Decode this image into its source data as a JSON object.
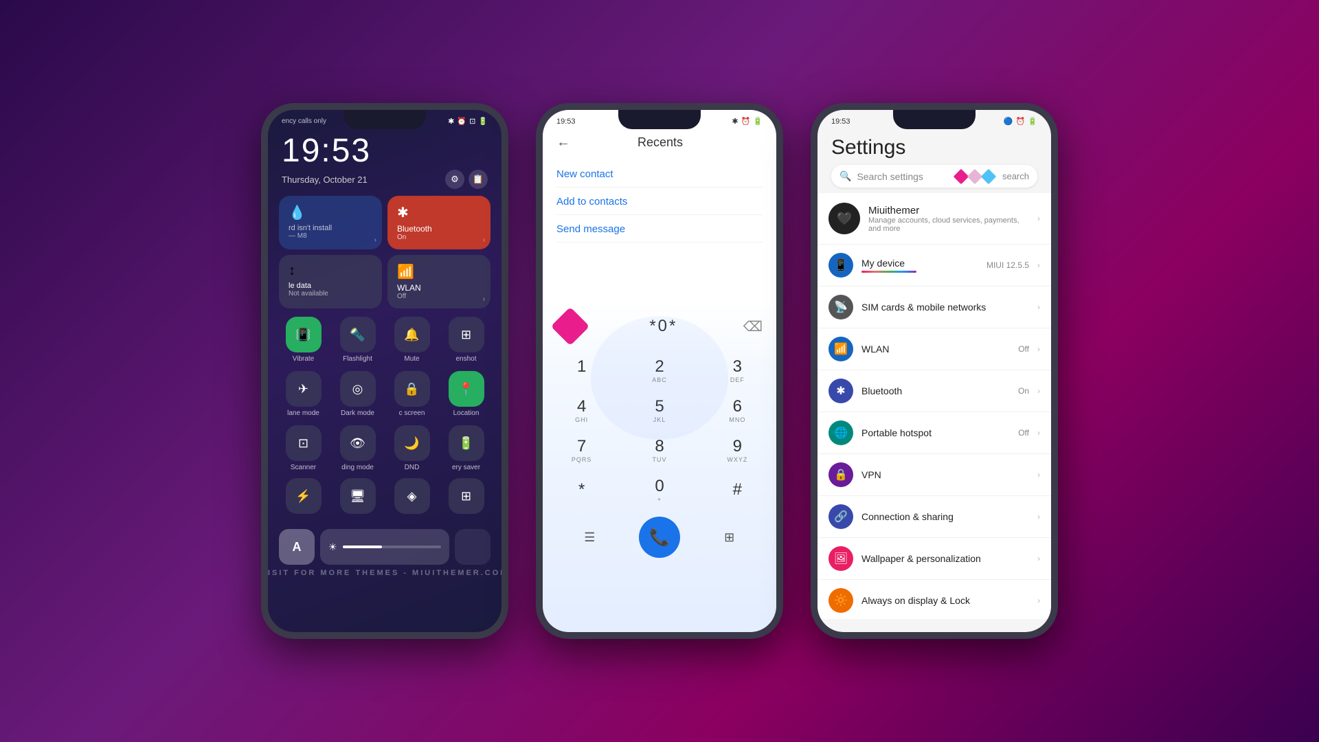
{
  "background": "#4a0060",
  "phone1": {
    "status": {
      "left": "ency calls only",
      "time": "19:53",
      "icons": [
        "bluetooth",
        "alarm",
        "screenshot",
        "battery"
      ]
    },
    "time": "19:53",
    "date": "Thursday, October 21",
    "tiles": [
      {
        "label": "M8",
        "sub": "rd isn't install",
        "icon": "💧",
        "type": "blue"
      },
      {
        "label": "Bluetooth",
        "sub": "On",
        "icon": "✱",
        "type": "red"
      },
      {
        "label": "le data",
        "sub": "Not available",
        "icon": "↕",
        "type": "gray"
      },
      {
        "label": "WLAN",
        "sub": "Off",
        "icon": "WiFi",
        "type": "gray"
      }
    ],
    "quick_actions_row1": [
      {
        "label": "Vibrate",
        "icon": "📳",
        "active": true
      },
      {
        "label": "Flashlight",
        "icon": "🔦",
        "active": false
      },
      {
        "label": "Mute",
        "icon": "🔔",
        "active": false
      },
      {
        "label": "enshot",
        "icon": "⊞",
        "active": false
      }
    ],
    "quick_actions_row2": [
      {
        "label": "lane mode",
        "icon": "✈",
        "active": false
      },
      {
        "label": "Dark mode",
        "icon": "◎",
        "active": false
      },
      {
        "label": "c screen",
        "icon": "🔒",
        "active": false
      },
      {
        "label": "Location",
        "icon": "◈",
        "active": true
      }
    ],
    "quick_actions_row3": [
      {
        "label": "Scanner",
        "icon": "⊡",
        "active": false
      },
      {
        "label": "ding mode",
        "icon": "👁",
        "active": false
      },
      {
        "label": "DND",
        "icon": "🌙",
        "active": false
      },
      {
        "label": "ery saver",
        "icon": "🔋",
        "active": false
      }
    ],
    "quick_actions_row4": [
      {
        "icon": "⚡",
        "active": false
      },
      {
        "icon": "⊟",
        "active": false
      },
      {
        "icon": "◈",
        "active": false
      },
      {
        "icon": "⊞",
        "active": false
      }
    ]
  },
  "phone2": {
    "status_time": "19:53",
    "header_title": "Recents",
    "back_icon": "←",
    "actions": [
      {
        "label": "New contact"
      },
      {
        "label": "Add to contacts"
      },
      {
        "label": "Send message"
      }
    ],
    "dial_number": "*0*",
    "dialpad": [
      {
        "num": "1",
        "alpha": ""
      },
      {
        "num": "2",
        "alpha": "ABC"
      },
      {
        "num": "3",
        "alpha": "DEF"
      },
      {
        "num": "4",
        "alpha": "GHI"
      },
      {
        "num": "5",
        "alpha": "JKL"
      },
      {
        "num": "6",
        "alpha": "MNO"
      },
      {
        "num": "7",
        "alpha": "PQRS"
      },
      {
        "num": "8",
        "alpha": "TUV"
      },
      {
        "num": "9",
        "alpha": "WXYZ"
      },
      {
        "num": "*",
        "alpha": ""
      },
      {
        "num": "0",
        "alpha": "+"
      },
      {
        "num": "#",
        "alpha": ""
      }
    ]
  },
  "phone3": {
    "status_time": "19:53",
    "title": "Settings",
    "search_placeholder": "Search settings",
    "search_btn": "search",
    "profile": {
      "name": "Miuithemer",
      "sub": "Manage accounts, cloud services, payments, and more",
      "icon": "🖤"
    },
    "my_device": {
      "label": "My device",
      "value": "MIUI 12.5.5"
    },
    "settings_items": [
      {
        "label": "SIM cards & mobile networks",
        "icon": "📡",
        "color": "si-gray",
        "value": ""
      },
      {
        "label": "WLAN",
        "icon": "📶",
        "color": "si-blue",
        "value": "Off"
      },
      {
        "label": "Bluetooth",
        "icon": "✱",
        "color": "si-indigo",
        "value": "On"
      },
      {
        "label": "Portable hotspot",
        "icon": "🌐",
        "color": "si-green",
        "value": "Off"
      },
      {
        "label": "VPN",
        "icon": "🔒",
        "color": "si-purple",
        "value": ""
      },
      {
        "label": "Connection & sharing",
        "icon": "🔗",
        "color": "si-indigo",
        "value": ""
      },
      {
        "label": "Wallpaper & personalization",
        "icon": "🖼",
        "color": "si-pink",
        "value": ""
      },
      {
        "label": "Always on display & Lock",
        "icon": "🔆",
        "color": "si-orange",
        "value": ""
      }
    ]
  },
  "watermark": "VISIT FOR MORE THEMES - MIUITHEMER.COM"
}
